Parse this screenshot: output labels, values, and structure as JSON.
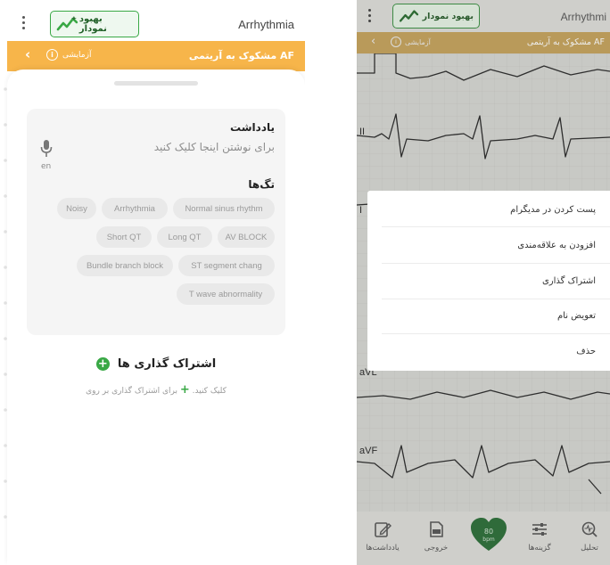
{
  "left": {
    "header": {
      "title": "Arrhythmia",
      "improve_label": "بهبود نمودار"
    },
    "suspect_bar": {
      "text": "مشکوک به آریتمی AF",
      "test_label": "آزمایشی"
    },
    "note": {
      "title": "یادداشت",
      "hint": "برای نوشتن اینجا کلیک کنید",
      "lang": "en"
    },
    "tags": {
      "title": "تگ‌ها",
      "items": [
        "Normal sinus rhythm",
        "Arrhythmia",
        "Noisy",
        "AV BLOCK",
        "Long QT",
        "Short QT",
        "ST segment chang",
        "Bundle branch block",
        "T wave abnormality"
      ]
    },
    "share": {
      "title": "اشتراک گذاری ها",
      "hint_before": "برای اشتراک گذاری بر روی",
      "hint_after": "کلیک کنید."
    }
  },
  "right": {
    "header": {
      "title": "Arrhythmi",
      "improve_label": "بهبود نمودار"
    },
    "suspect_bar": {
      "text": "مشکوک به آریتمی AF",
      "test_label": "آزمایشی"
    },
    "leads": [
      "II",
      "I",
      "aVL",
      "aVF"
    ],
    "menu": [
      "پست کردن در مدیگرام",
      "افزودن به علاقه‌مندی",
      "اشتراک گذاری",
      "تعویض نام",
      "حذف"
    ],
    "bottom_nav": {
      "analysis": "تحلیل",
      "options": "گزینه‌ها",
      "export": "خروجی",
      "notes": "یادداشت‌ها",
      "heart_rate": "80",
      "heart_unit": "bpm"
    }
  },
  "colors": {
    "accent_green": "#39a845",
    "suspect_orange": "#f7b54a",
    "chip_bg": "#e9e9e9"
  }
}
